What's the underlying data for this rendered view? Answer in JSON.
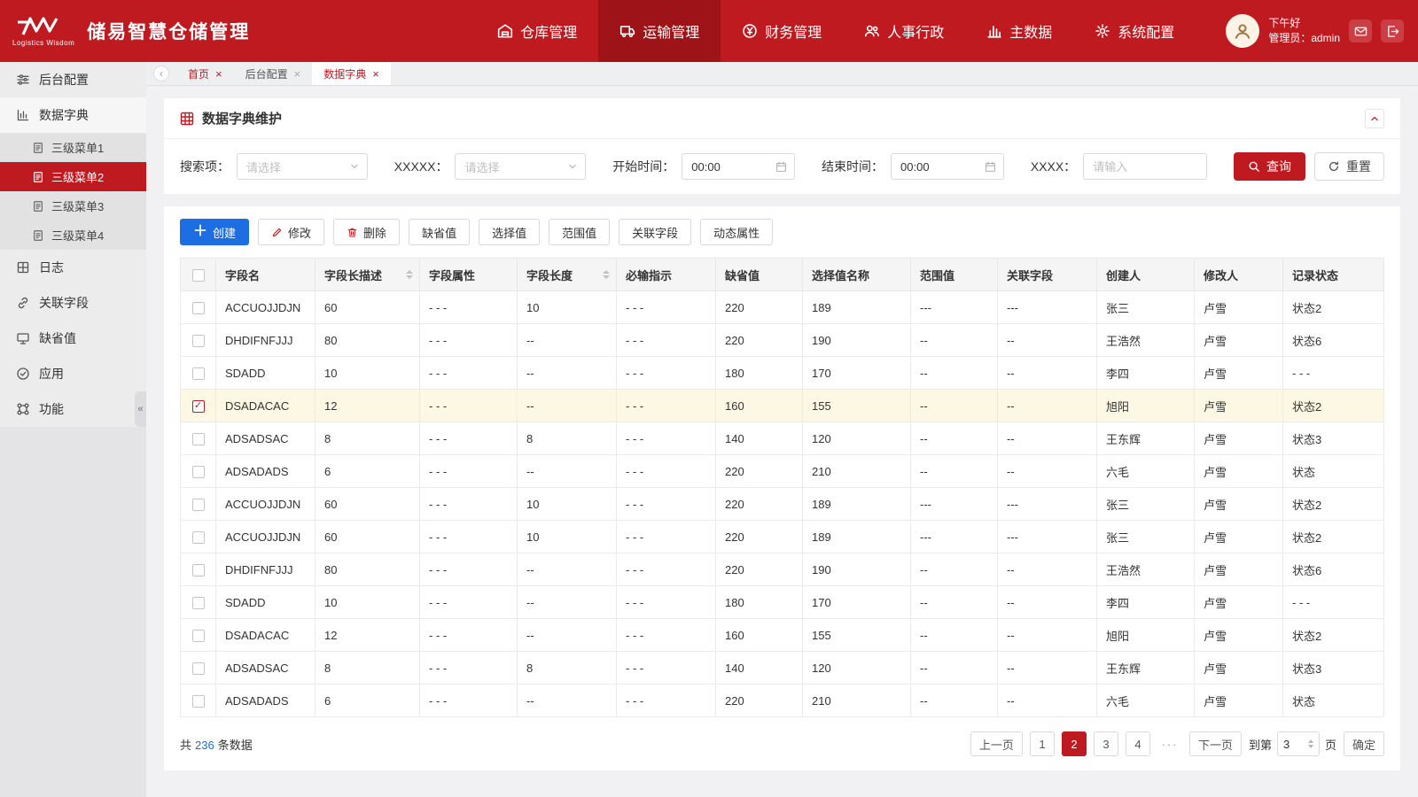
{
  "header": {
    "logo_caption": "Logistics Wisdom",
    "app_title": "储易智慧仓储管理",
    "nav": [
      {
        "label": "仓库管理"
      },
      {
        "label": "运输管理",
        "active": true
      },
      {
        "label": "财务管理"
      },
      {
        "label": "人事行政"
      },
      {
        "label": "主数据"
      },
      {
        "label": "系统配置"
      }
    ],
    "greeting": "下午好",
    "user": "管理员：admin"
  },
  "tabs": [
    {
      "label": "首页",
      "highlight": true
    },
    {
      "label": "后台配置"
    },
    {
      "label": "数据字典",
      "active": true
    }
  ],
  "sidebar": {
    "items": [
      {
        "label": "后台配置"
      },
      {
        "label": "数据字典"
      },
      {
        "label": "三级菜单1"
      },
      {
        "label": "三级菜单2",
        "active": true
      },
      {
        "label": "三级菜单3"
      },
      {
        "label": "三级菜单4"
      },
      {
        "label": "日志"
      },
      {
        "label": "关联字段"
      },
      {
        "label": "缺省值"
      },
      {
        "label": "应用"
      },
      {
        "label": "功能"
      }
    ]
  },
  "panel": {
    "title": "数据字典维护"
  },
  "search": {
    "fields": [
      {
        "label": "搜索项：",
        "placeholder": "请选择"
      },
      {
        "label": "XXXXX：",
        "placeholder": "请选择"
      },
      {
        "label": "开始时间：",
        "value": "00:00"
      },
      {
        "label": "结束时间：",
        "value": "00:00"
      },
      {
        "label": "XXXX：",
        "placeholder": "请输入"
      }
    ],
    "query_label": "查询",
    "reset_label": "重置"
  },
  "toolbar": {
    "create": "创建",
    "edit": "修改",
    "delete": "删除",
    "plain": [
      "缺省值",
      "选择值",
      "范围值",
      "关联字段",
      "动态属性"
    ]
  },
  "table": {
    "columns": [
      {
        "label": "字段名"
      },
      {
        "label": "字段长描述",
        "sortable": true
      },
      {
        "label": "字段属性"
      },
      {
        "label": "字段长度",
        "sortable": true
      },
      {
        "label": "必输指示"
      },
      {
        "label": "缺省值"
      },
      {
        "label": "选择值名称"
      },
      {
        "label": "范围值"
      },
      {
        "label": "关联字段"
      },
      {
        "label": "创建人"
      },
      {
        "label": "修改人"
      },
      {
        "label": "记录状态"
      }
    ],
    "rows": [
      {
        "checked": false,
        "selected": false,
        "cells": [
          "ACCUOJJDJN",
          "60",
          "- - -",
          "10",
          "- - -",
          "220",
          "189",
          "---",
          "---",
          "张三",
          "卢雪",
          "状态2"
        ]
      },
      {
        "checked": false,
        "selected": false,
        "cells": [
          "DHDIFNFJJJ",
          "80",
          "- - -",
          "--",
          "- - -",
          "220",
          "190",
          "--",
          "--",
          "王浩然",
          "卢雪",
          "状态6"
        ]
      },
      {
        "checked": false,
        "selected": false,
        "cells": [
          "SDADD",
          "10",
          "- - -",
          "--",
          "- - -",
          "180",
          "170",
          "--",
          "--",
          "李四",
          "卢雪",
          "- - -"
        ]
      },
      {
        "checked": true,
        "selected": true,
        "cells": [
          "DSADACAC",
          "12",
          "- - -",
          "--",
          "- - -",
          "160",
          "155",
          "--",
          "--",
          "旭阳",
          "卢雪",
          "状态2"
        ]
      },
      {
        "checked": false,
        "selected": false,
        "cells": [
          "ADSADSAC",
          "8",
          "- - -",
          "8",
          "- - -",
          "140",
          "120",
          "--",
          "--",
          "王东辉",
          "卢雪",
          "状态3"
        ]
      },
      {
        "checked": false,
        "selected": false,
        "cells": [
          "ADSADADS",
          "6",
          "- - -",
          "--",
          "- - -",
          "220",
          "210",
          "--",
          "--",
          "六毛",
          "卢雪",
          "状态"
        ]
      },
      {
        "checked": false,
        "selected": false,
        "cells": [
          "ACCUOJJDJN",
          "60",
          "- - -",
          "10",
          "- - -",
          "220",
          "189",
          "---",
          "---",
          "张三",
          "卢雪",
          "状态2"
        ]
      },
      {
        "checked": false,
        "selected": false,
        "cells": [
          "ACCUOJJDJN",
          "60",
          "- - -",
          "10",
          "- - -",
          "220",
          "189",
          "---",
          "---",
          "张三",
          "卢雪",
          "状态2"
        ]
      },
      {
        "checked": false,
        "selected": false,
        "cells": [
          "DHDIFNFJJJ",
          "80",
          "- - -",
          "--",
          "- - -",
          "220",
          "190",
          "--",
          "--",
          "王浩然",
          "卢雪",
          "状态6"
        ]
      },
      {
        "checked": false,
        "selected": false,
        "cells": [
          "SDADD",
          "10",
          "- - -",
          "--",
          "- - -",
          "180",
          "170",
          "--",
          "--",
          "李四",
          "卢雪",
          "- - -"
        ]
      },
      {
        "checked": false,
        "selected": false,
        "cells": [
          "DSADACAC",
          "12",
          "- - -",
          "--",
          "- - -",
          "160",
          "155",
          "--",
          "--",
          "旭阳",
          "卢雪",
          "状态2"
        ]
      },
      {
        "checked": false,
        "selected": false,
        "cells": [
          "ADSADSAC",
          "8",
          "- - -",
          "8",
          "- - -",
          "140",
          "120",
          "--",
          "--",
          "王东辉",
          "卢雪",
          "状态3"
        ]
      },
      {
        "checked": false,
        "selected": false,
        "cells": [
          "ADSADADS",
          "6",
          "- - -",
          "--",
          "- - -",
          "220",
          "210",
          "--",
          "--",
          "六毛",
          "卢雪",
          "状态"
        ]
      }
    ]
  },
  "pagination": {
    "total_prefix": "共",
    "total": "236",
    "total_suffix": "条数据",
    "prev": "上一页",
    "pages": [
      "1",
      "2",
      "3",
      "4"
    ],
    "active_page": "2",
    "ellipsis": "···",
    "next": "下一页",
    "goto_prefix": "到第",
    "goto_value": "3",
    "goto_suffix": "页",
    "confirm": "确定"
  },
  "colors": {
    "primary": "#c01a21",
    "primary_dark": "#9e1317",
    "accent_blue": "#1d6ee2",
    "link_blue": "#1a6ee0",
    "row_selected": "#fcf8e3"
  }
}
